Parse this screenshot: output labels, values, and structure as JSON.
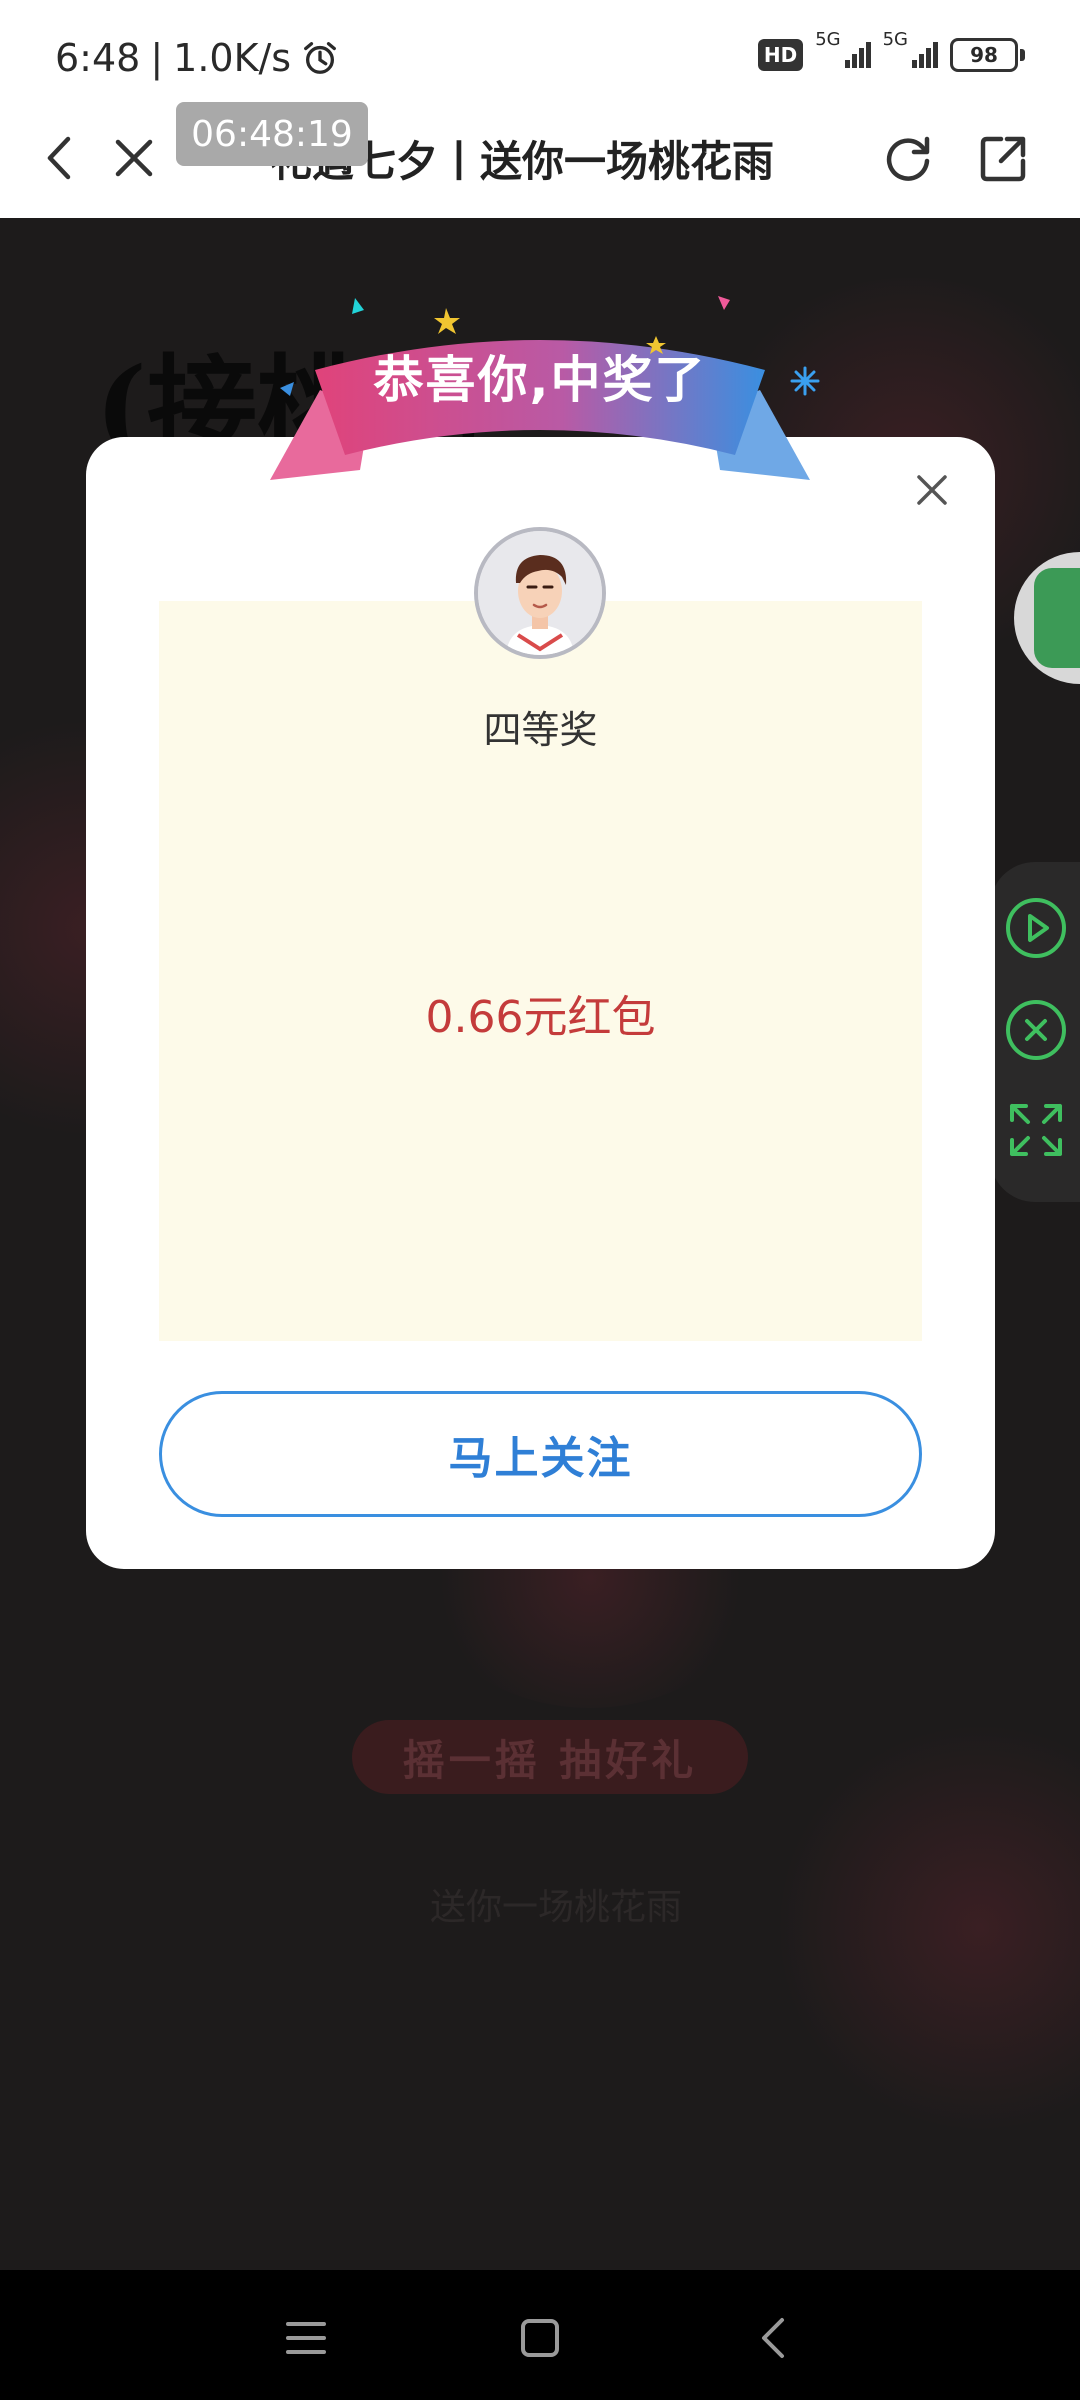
{
  "status_bar": {
    "time": "6:48",
    "speed": "1.0K/s",
    "hd_label": "HD",
    "network_1": "5G",
    "network_2": "5G",
    "battery": "98"
  },
  "title_bar": {
    "title": "礼遇七夕丨送你一场桃花雨",
    "timestamp": "06:48:19"
  },
  "background": {
    "heading": "(接桃花",
    "shake_button": "摇一摇 抽好礼",
    "faint_line": "送你一场桃花雨"
  },
  "modal": {
    "banner_text": "恭喜你,中奖了",
    "prize_level": "四等奖",
    "prize_amount": "0.66元红包",
    "follow_button": "马上关注"
  },
  "colors": {
    "accent_blue": "#2f7fd6",
    "prize_red": "#c43b3b",
    "panel_bg": "#fdfae9",
    "ribbon_pink": "#e0437a",
    "ribbon_blue": "#3a8fe0",
    "control_green": "#3fbf5f"
  }
}
